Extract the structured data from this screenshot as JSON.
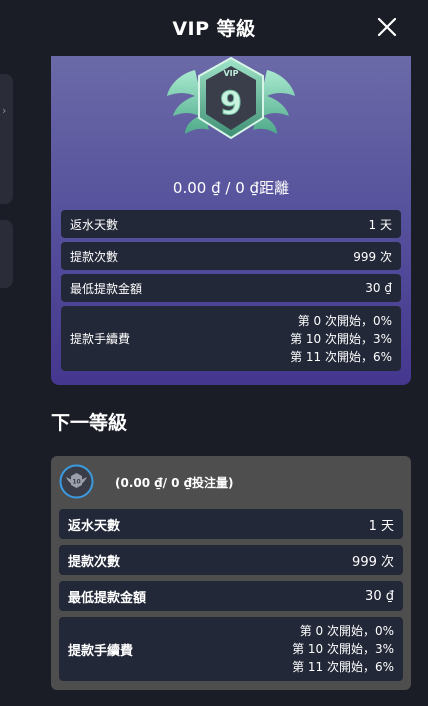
{
  "header": {
    "title": "VIP 等級"
  },
  "current_level": {
    "badge_label": "VIP",
    "badge_level": "9",
    "distance_text": "0.00 ₫ / 0 ₫距離",
    "rows": [
      {
        "label": "返水天數",
        "value": "1 天"
      },
      {
        "label": "提款次數",
        "value": "999 次"
      },
      {
        "label": "最低提款金額",
        "value": "30 ₫"
      }
    ],
    "fee": {
      "label": "提款手續費",
      "lines": [
        "第 0 次開始，0%",
        "第 10 次開始，3%",
        "第 11 次開始，6%"
      ]
    }
  },
  "next_level": {
    "section_title": "下一等級",
    "badge_level": "10",
    "subtitle": "(0.00 ₫/ 0 ₫投注量)",
    "rows": [
      {
        "label": "返水天數",
        "value": "1 天"
      },
      {
        "label": "提款次數",
        "value": "999 次"
      },
      {
        "label": "最低提款金額",
        "value": "30 ₫"
      }
    ],
    "fee": {
      "label": "提款手續費",
      "lines": [
        "第 0 次開始，0%",
        "第 10 次開始，3%",
        "第 11 次開始，6%"
      ]
    }
  },
  "colors": {
    "background": "#1a1c26",
    "card_gradient_top": "#6b6aa8",
    "card_gradient_bottom": "#45378f",
    "row_bg": "#232838",
    "next_card_bg": "#4e4e4e",
    "badge_green": "#8fd9b8"
  }
}
